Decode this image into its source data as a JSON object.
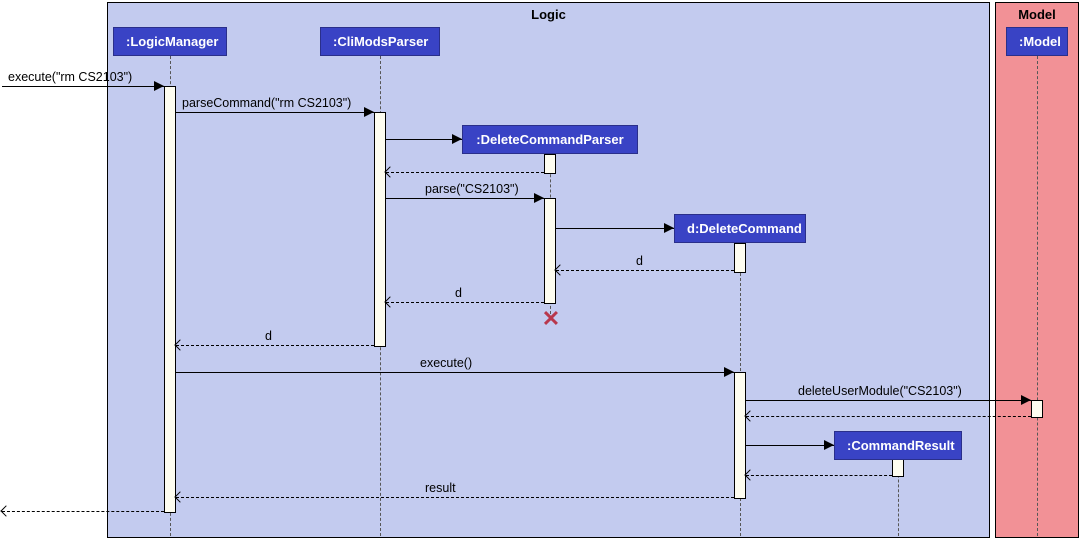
{
  "frames": {
    "logic": {
      "title": "Logic"
    },
    "model": {
      "title": "Model"
    }
  },
  "participants": {
    "logicManager": ":LogicManager",
    "cliModsParser": ":CliModsParser",
    "deleteCommandParser": ":DeleteCommandParser",
    "deleteCommand": "d:DeleteCommand",
    "commandResult": ":CommandResult",
    "model": ":Model"
  },
  "messages": {
    "executeIn": "execute(\"rm CS2103\")",
    "parseCommand": "parseCommand(\"rm CS2103\")",
    "parse": "parse(\"CS2103\")",
    "returnD1": "d",
    "returnD2": "d",
    "returnD3": "d",
    "execute": "execute()",
    "deleteUserModule": "deleteUserModule(\"CS2103\")",
    "result": "result"
  },
  "chart_data": {
    "type": "sequence_diagram",
    "frames": [
      {
        "name": "Logic",
        "kind": "package"
      },
      {
        "name": "Model",
        "kind": "package"
      }
    ],
    "participants": [
      {
        "id": "lm",
        "label": ":LogicManager",
        "frame": "Logic"
      },
      {
        "id": "cmp",
        "label": ":CliModsParser",
        "frame": "Logic"
      },
      {
        "id": "dcp",
        "label": ":DeleteCommandParser",
        "frame": "Logic",
        "created": true,
        "destroyed": true
      },
      {
        "id": "dc",
        "label": "d:DeleteCommand",
        "frame": "Logic",
        "created": true
      },
      {
        "id": "cr",
        "label": ":CommandResult",
        "frame": "Logic",
        "created": true
      },
      {
        "id": "m",
        "label": ":Model",
        "frame": "Model"
      }
    ],
    "messages": [
      {
        "from": "external",
        "to": "lm",
        "label": "execute(\"rm CS2103\")",
        "type": "sync"
      },
      {
        "from": "lm",
        "to": "cmp",
        "label": "parseCommand(\"rm CS2103\")",
        "type": "sync"
      },
      {
        "from": "cmp",
        "to": "dcp",
        "label": "",
        "type": "create"
      },
      {
        "from": "dcp",
        "to": "cmp",
        "label": "",
        "type": "return"
      },
      {
        "from": "cmp",
        "to": "dcp",
        "label": "parse(\"CS2103\")",
        "type": "sync"
      },
      {
        "from": "dcp",
        "to": "dc",
        "label": "",
        "type": "create"
      },
      {
        "from": "dc",
        "to": "dcp",
        "label": "d",
        "type": "return"
      },
      {
        "from": "dcp",
        "to": "cmp",
        "label": "d",
        "type": "return"
      },
      {
        "from": "dcp",
        "to": null,
        "label": "",
        "type": "destroy"
      },
      {
        "from": "cmp",
        "to": "lm",
        "label": "d",
        "type": "return"
      },
      {
        "from": "lm",
        "to": "dc",
        "label": "execute()",
        "type": "sync"
      },
      {
        "from": "dc",
        "to": "m",
        "label": "deleteUserModule(\"CS2103\")",
        "type": "sync"
      },
      {
        "from": "m",
        "to": "dc",
        "label": "",
        "type": "return"
      },
      {
        "from": "dc",
        "to": "cr",
        "label": "",
        "type": "create"
      },
      {
        "from": "cr",
        "to": "dc",
        "label": "",
        "type": "return"
      },
      {
        "from": "dc",
        "to": "lm",
        "label": "result",
        "type": "return"
      },
      {
        "from": "lm",
        "to": "external",
        "label": "",
        "type": "return"
      }
    ]
  }
}
